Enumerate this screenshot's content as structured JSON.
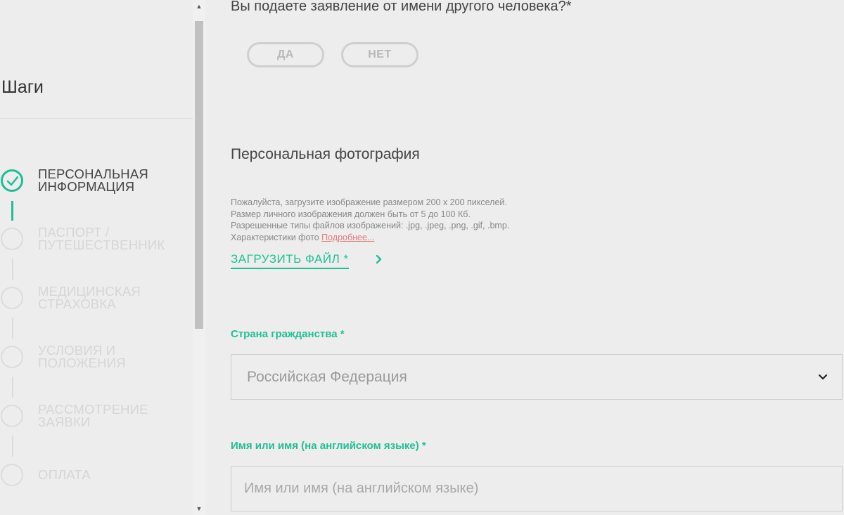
{
  "sidebar": {
    "title": "Шаги",
    "steps": [
      {
        "label": "Персональная информация",
        "status": "done"
      },
      {
        "label": "Паспорт / путешественник",
        "status": "pending"
      },
      {
        "label": "Медицинская страховка",
        "status": "pending"
      },
      {
        "label": "Условия и положения",
        "status": "pending"
      },
      {
        "label": "Рассмотрение заявки",
        "status": "pending"
      },
      {
        "label": "Оплата",
        "status": "pending"
      }
    ]
  },
  "form": {
    "question": "Вы подаете заявление от имени другого человека?*",
    "yes_label": "ДА",
    "no_label": "НЕТ",
    "photo_section_title": "Персональная фотография",
    "photo_help": {
      "line1": "Пожалуйста, загрузите изображение размером 200 x 200 пикселей.",
      "line2": "Размер личного изображения должен быть от 5 до 100 Кб.",
      "line3": "Разрешенные типы файлов изображений: .jpg, .jpeg, .png, .gif, .bmp.",
      "line4_prefix": "Характеристики фото",
      "more_link": "Подробнее..."
    },
    "upload_label": "ЗАГРУЗИТЬ ФАЙЛ *",
    "citizenship_label": "Страна гражданства *",
    "citizenship_value": "Российская Федерация",
    "name_label": "Имя или имя (на английском языке) *",
    "name_placeholder": "Имя или имя (на английском языке)",
    "name_value": ""
  },
  "colors": {
    "accent": "#1fbf95",
    "link": "#e57a7a",
    "background": "#ededed"
  },
  "icons": {
    "step_done": "check-icon",
    "select": "chevron-down-icon",
    "upload": "chevron-right-icon"
  }
}
